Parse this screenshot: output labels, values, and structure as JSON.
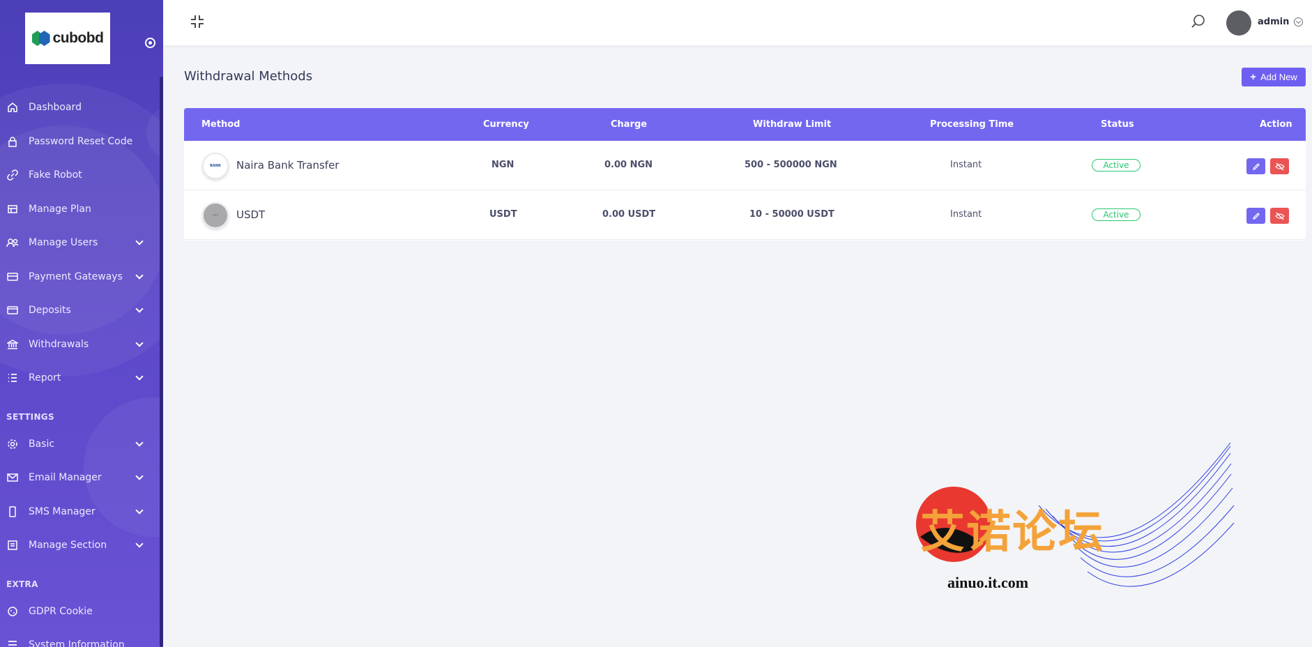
{
  "sidebar": {
    "logo_text": "cubobd",
    "items": [
      {
        "label": "Dashboard",
        "icon": "home-icon",
        "has_children": false
      },
      {
        "label": "Password Reset Code",
        "icon": "lock-icon",
        "has_children": false
      },
      {
        "label": "Fake Robot",
        "icon": "link-icon",
        "has_children": false
      },
      {
        "label": "Manage Plan",
        "icon": "plan-icon",
        "has_children": false
      },
      {
        "label": "Manage Users",
        "icon": "users-icon",
        "has_children": true
      },
      {
        "label": "Payment Gateways",
        "icon": "card-icon",
        "has_children": true
      },
      {
        "label": "Deposits",
        "icon": "wallet-icon",
        "has_children": true
      },
      {
        "label": "Withdrawals",
        "icon": "bank-icon",
        "has_children": true
      },
      {
        "label": "Report",
        "icon": "list-icon",
        "has_children": true
      }
    ],
    "settings_heading": "SETTINGS",
    "settings_items": [
      {
        "label": "Basic",
        "icon": "gear-icon",
        "has_children": true
      },
      {
        "label": "Email Manager",
        "icon": "mail-icon",
        "has_children": true
      },
      {
        "label": "SMS Manager",
        "icon": "phone-icon",
        "has_children": true
      },
      {
        "label": "Manage Section",
        "icon": "section-icon",
        "has_children": true
      }
    ],
    "extra_heading": "EXTRA",
    "extra_items": [
      {
        "label": "GDPR Cookie",
        "icon": "cookie-icon",
        "has_children": false
      },
      {
        "label": "System Information",
        "icon": "info-icon",
        "has_children": false
      }
    ]
  },
  "topbar": {
    "user_name": "admin"
  },
  "main": {
    "title": "Withdrawal Methods",
    "add_button": "Add New",
    "columns": [
      "Method",
      "Currency",
      "Charge",
      "Withdraw Limit",
      "Processing Time",
      "Status",
      "Action"
    ],
    "rows": [
      {
        "method": "Naira Bank Transfer",
        "currency": "NGN",
        "charge": "0.00 NGN",
        "limit": "500 - 500000 NGN",
        "processing": "Instant",
        "status": "Active"
      },
      {
        "method": "USDT",
        "currency": "USDT",
        "charge": "0.00 USDT",
        "limit": "10 - 50000 USDT",
        "processing": "Instant",
        "status": "Active"
      }
    ]
  },
  "watermark": {
    "text": "艾诺论坛",
    "url": "ainuo.it.com"
  },
  "colors": {
    "sidebar": "#5b47c9",
    "accent": "#7367f0",
    "success": "#28c76f",
    "danger": "#ea5455"
  }
}
